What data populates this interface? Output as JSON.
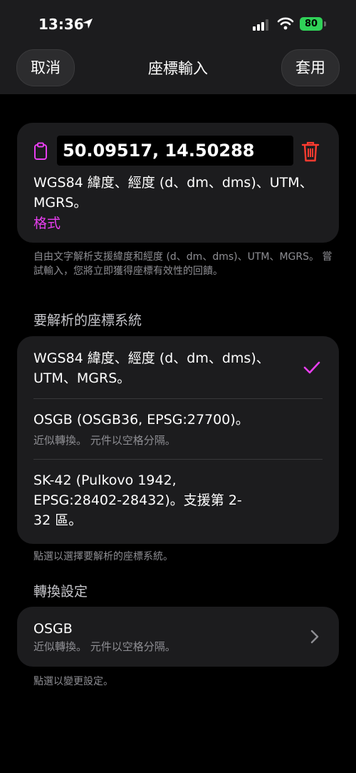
{
  "status": {
    "time": "13:36",
    "battery": "80"
  },
  "nav": {
    "cancel": "取消",
    "title": "座標輸入",
    "apply": "套用"
  },
  "input": {
    "value": "50.09517, 14.50288",
    "description": "WGS84 緯度、經度 (d、dm、dms)、UTM、MGRS。",
    "format_link": "格式"
  },
  "input_help": "自由文字解析支援緯度和經度 (d、dm、dms)、UTM、MGRS。 嘗試輸入，您將立即獲得座標有效性的回饋。",
  "systems": {
    "header": "要解析的座標系統",
    "items": [
      {
        "label": "WGS84 緯度、經度 (d、dm、dms)、UTM、MGRS。",
        "sub": "",
        "checked": true
      },
      {
        "label": "OSGB (OSGB36, EPSG:27700)。",
        "sub": "近似轉換。 元件以空格分隔。"
      },
      {
        "label": "SK-42 (Pulkovo 1942, EPSG:28402-28432)。支援第 2-32 區。",
        "sub": ""
      }
    ],
    "footer": "點選以選擇要解析的座標系統。"
  },
  "conversion": {
    "header": "轉換設定",
    "item_label": "OSGB",
    "item_sub": "近似轉換。 元件以空格分隔。",
    "footer": "點選以變更設定。"
  },
  "colors": {
    "accent": "#e83ef0",
    "trash": "#ff3b30",
    "battery": "#30d158"
  }
}
